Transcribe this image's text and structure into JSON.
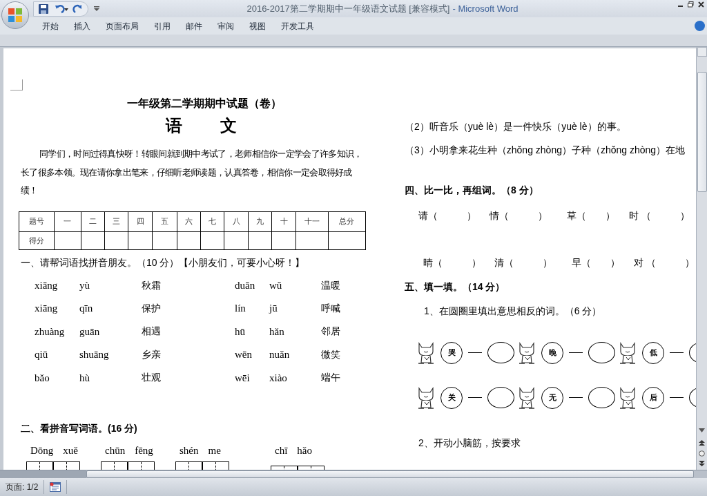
{
  "window": {
    "title": "2016-2017第二学期期中一年级语文试题 [兼容模式]",
    "app": "- Microsoft Word"
  },
  "ribbon_tabs": [
    "开始",
    "插入",
    "页面布局",
    "引用",
    "邮件",
    "审阅",
    "视图",
    "开发工具"
  ],
  "left_column": {
    "title": "一年级第二学期期中试题（卷）",
    "subject": [
      "语",
      "文"
    ],
    "intro": "同学们，时间过得真快呀！转眼间就到期中考试了，老师相信你一定学会了许多知识，长了很多本领。现在请你拿出笔来，仔细听老师读题，认真答卷，相信你一定会取得好成绩！",
    "score_table": {
      "columns": [
        "题号",
        "一",
        "二",
        "三",
        "四",
        "五",
        "六",
        "七",
        "八",
        "九",
        "十",
        "十一",
        "总分"
      ],
      "row_label": "得分"
    },
    "section_1": {
      "heading": "一、请帮词语找拼音朋友。（10 分）【小朋友们，可要小心呀！】",
      "rows": [
        [
          "xiāng",
          "yù",
          "秋霜",
          "duān",
          "wǔ",
          "温暖"
        ],
        [
          "xiāng",
          "qīn",
          "保护",
          "lín",
          "jū",
          "呼喊"
        ],
        [
          "zhuàng",
          "guān",
          "相遇",
          "hū",
          "hǎn",
          "邻居"
        ],
        [
          "qiū",
          "shuāng",
          "乡亲",
          "wēn",
          "nuǎn",
          "微笑"
        ],
        [
          "bǎo",
          "hù",
          "壮观",
          "wēi",
          "xiào",
          "端午"
        ]
      ]
    },
    "section_2": {
      "heading": "二、看拼音写词语。(16 分)",
      "words": [
        [
          "Dōng",
          "xuě"
        ],
        [
          "chūn",
          "fēng"
        ],
        [
          "shén",
          "me"
        ],
        [
          "chī",
          "hǎo"
        ]
      ]
    }
  },
  "right_column": {
    "lines": [
      "（2）听音乐（yuè lè）是一件快乐（yuè lè）的事。",
      "（3）小明拿来花生种（zhǒng zhòng）子种（zhǒng zhòng）在地"
    ],
    "section_4": {
      "heading": "四、比一比，再组词。（8 分）",
      "rows": [
        [
          "请（　　　）",
          "情（　　　）",
          "草（　　）",
          "时 （　　　）"
        ],
        [
          "晴（　　　）",
          "清（　　　）",
          "早（　　）",
          "对 （　　　）"
        ]
      ]
    },
    "section_5": {
      "heading": "五、填一填。（14 分）",
      "task_1": "1、在圆圈里填出意思相反的词。（6 分）",
      "circle_rows": [
        [
          "哭",
          "晚",
          "低"
        ],
        [
          "关",
          "无",
          "后"
        ]
      ],
      "task_2": "2、开动小脑筋，按要求"
    }
  },
  "status_bar": {
    "page": "页面: 1/2"
  }
}
